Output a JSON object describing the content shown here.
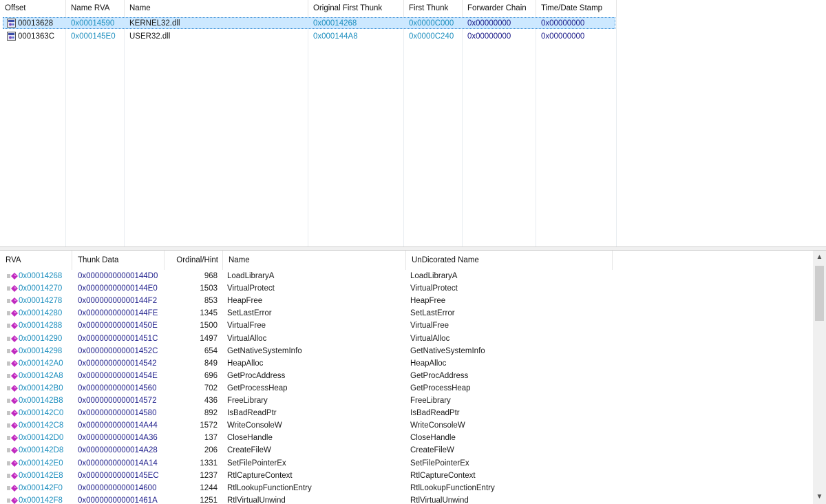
{
  "imports_table": {
    "columns": [
      "Offset",
      "Name RVA",
      "Name",
      "Original First Thunk",
      "First Thunk",
      "Forwarder Chain",
      "Time/Date Stamp"
    ],
    "rows": [
      {
        "offset": "00013628",
        "name_rva": "0x00014590",
        "name": "KERNEL32.dll",
        "original_first_thunk": "0x00014268",
        "first_thunk": "0x0000C000",
        "forwarder_chain": "0x00000000",
        "time_date_stamp": "0x00000000",
        "selected": true
      },
      {
        "offset": "0001363C",
        "name_rva": "0x000145E0",
        "name": "USER32.dll",
        "original_first_thunk": "0x000144A8",
        "first_thunk": "0x0000C240",
        "forwarder_chain": "0x00000000",
        "time_date_stamp": "0x00000000",
        "selected": false
      }
    ]
  },
  "functions_table": {
    "columns": [
      "RVA",
      "Thunk Data",
      "Ordinal/Hint",
      "Name",
      "UnDicorated Name"
    ],
    "rows": [
      {
        "rva": "0x00014268",
        "thunk": "0x00000000000144D0",
        "hint": "968",
        "name": "LoadLibraryA",
        "undecorated": "LoadLibraryA"
      },
      {
        "rva": "0x00014270",
        "thunk": "0x00000000000144E0",
        "hint": "1503",
        "name": "VirtualProtect",
        "undecorated": "VirtualProtect"
      },
      {
        "rva": "0x00014278",
        "thunk": "0x00000000000144F2",
        "hint": "853",
        "name": "HeapFree",
        "undecorated": "HeapFree"
      },
      {
        "rva": "0x00014280",
        "thunk": "0x00000000000144FE",
        "hint": "1345",
        "name": "SetLastError",
        "undecorated": "SetLastError"
      },
      {
        "rva": "0x00014288",
        "thunk": "0x000000000001450E",
        "hint": "1500",
        "name": "VirtualFree",
        "undecorated": "VirtualFree"
      },
      {
        "rva": "0x00014290",
        "thunk": "0x000000000001451C",
        "hint": "1497",
        "name": "VirtualAlloc",
        "undecorated": "VirtualAlloc"
      },
      {
        "rva": "0x00014298",
        "thunk": "0x000000000001452C",
        "hint": "654",
        "name": "GetNativeSystemInfo",
        "undecorated": "GetNativeSystemInfo"
      },
      {
        "rva": "0x000142A0",
        "thunk": "0x0000000000014542",
        "hint": "849",
        "name": "HeapAlloc",
        "undecorated": "HeapAlloc"
      },
      {
        "rva": "0x000142A8",
        "thunk": "0x000000000001454E",
        "hint": "696",
        "name": "GetProcAddress",
        "undecorated": "GetProcAddress"
      },
      {
        "rva": "0x000142B0",
        "thunk": "0x0000000000014560",
        "hint": "702",
        "name": "GetProcessHeap",
        "undecorated": "GetProcessHeap"
      },
      {
        "rva": "0x000142B8",
        "thunk": "0x0000000000014572",
        "hint": "436",
        "name": "FreeLibrary",
        "undecorated": "FreeLibrary"
      },
      {
        "rva": "0x000142C0",
        "thunk": "0x0000000000014580",
        "hint": "892",
        "name": "IsBadReadPtr",
        "undecorated": "IsBadReadPtr"
      },
      {
        "rva": "0x000142C8",
        "thunk": "0x0000000000014A44",
        "hint": "1572",
        "name": "WriteConsoleW",
        "undecorated": "WriteConsoleW"
      },
      {
        "rva": "0x000142D0",
        "thunk": "0x0000000000014A36",
        "hint": "137",
        "name": "CloseHandle",
        "undecorated": "CloseHandle"
      },
      {
        "rva": "0x000142D8",
        "thunk": "0x0000000000014A28",
        "hint": "206",
        "name": "CreateFileW",
        "undecorated": "CreateFileW"
      },
      {
        "rva": "0x000142E0",
        "thunk": "0x0000000000014A14",
        "hint": "1331",
        "name": "SetFilePointerEx",
        "undecorated": "SetFilePointerEx"
      },
      {
        "rva": "0x000142E8",
        "thunk": "0x00000000000145EC",
        "hint": "1237",
        "name": "RtlCaptureContext",
        "undecorated": "RtlCaptureContext"
      },
      {
        "rva": "0x000142F0",
        "thunk": "0x0000000000014600",
        "hint": "1244",
        "name": "RtlLookupFunctionEntry",
        "undecorated": "RtlLookupFunctionEntry"
      },
      {
        "rva": "0x000142F8",
        "thunk": "0x000000000001461A",
        "hint": "1251",
        "name": "RtlVirtualUnwind",
        "undecorated": "RtlVirtualUnwind"
      }
    ]
  },
  "icons": {
    "dll": "dll-file-icon",
    "function": "import-function-icon",
    "scroll_up": "chevron-up-icon",
    "scroll_down": "chevron-down-icon"
  },
  "colors": {
    "rva_text": "#1e8fbf",
    "value_text": "#1c1c8a",
    "selection": "#cce8ff"
  }
}
